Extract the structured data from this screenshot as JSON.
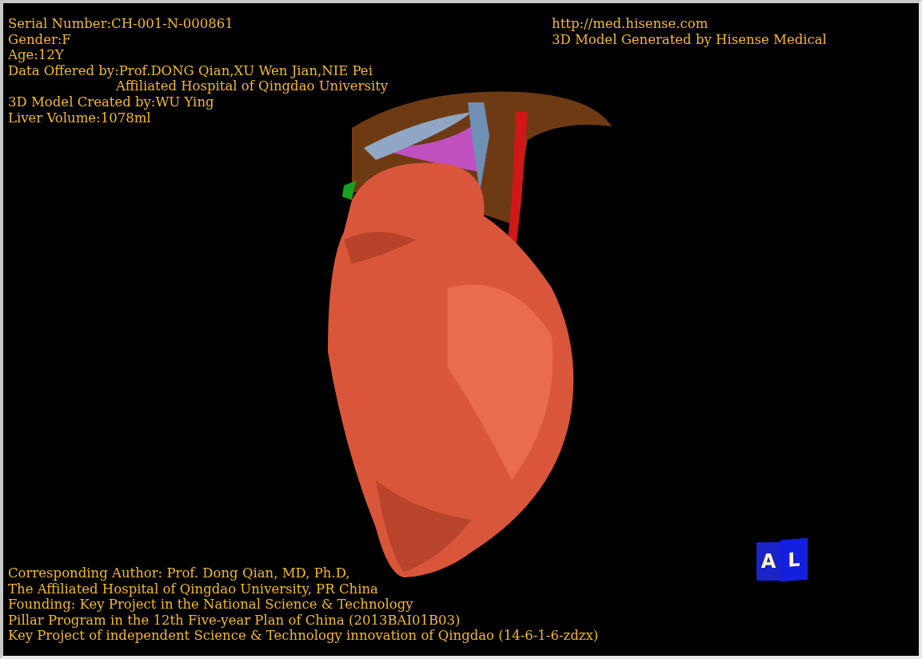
{
  "info_top_left": [
    {
      "text": "Serial Number:CH-001-N-000861",
      "kind": "line"
    },
    {
      "text": "Gender:F",
      "kind": "line"
    },
    {
      "text": "Age:12Y",
      "kind": "line"
    },
    {
      "text": "Data Offered by:Prof.DONG Qian,XU Wen Jian,NIE Pei",
      "kind": "line"
    },
    {
      "text": "Affiliated Hospital of Qingdao University",
      "kind": "continuation"
    },
    {
      "text": "3D Model Created by:WU Ying",
      "kind": "line"
    },
    {
      "text": "Liver Volume:1078ml",
      "kind": "line"
    }
  ],
  "info_top_right": [
    {
      "text": "http://med.hisense.com"
    },
    {
      "text": "3D Model Generated by Hisense Medical"
    }
  ],
  "info_bottom_left": [
    {
      "text": "Corresponding Author: Prof. Dong Qian, MD, Ph.D,"
    },
    {
      "text": "The Affiliated Hospital of Qingdao University, PR China"
    },
    {
      "text": "Founding: Key Project in the National Science & Technology"
    },
    {
      "text": "Pillar Program in the 12th Five-year Plan of China (2013BAI01B03)"
    },
    {
      "text": "Key Project of independent Science & Technology innovation of Qingdao (14-6-1-6-zdzx)"
    }
  ],
  "orientation_cube": {
    "front": "A",
    "side": "L"
  }
}
